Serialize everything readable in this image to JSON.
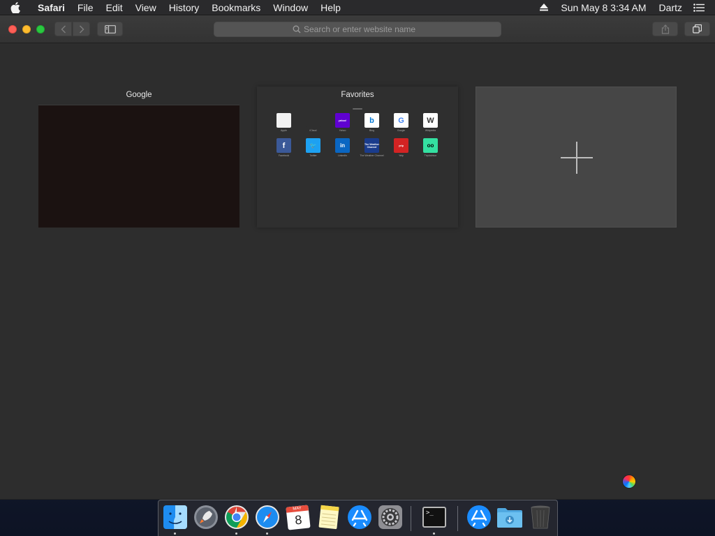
{
  "menubar": {
    "app_name": "Safari",
    "items": [
      "File",
      "Edit",
      "View",
      "History",
      "Bookmarks",
      "Window",
      "Help"
    ],
    "datetime": "Sun May 8  3:34 AM",
    "user": "Dartz"
  },
  "toolbar": {
    "address_placeholder": "Search or enter website name"
  },
  "tabs": {
    "google_title": "Google",
    "favorites_title": "Favorites"
  },
  "favorites": [
    {
      "label": "Apple",
      "icon": "apple-icon",
      "bg": "#f2f2f2",
      "fg": "#555555",
      "glyph": ""
    },
    {
      "label": "iCloud",
      "icon": "apple-icon",
      "bg": "#2f2f2f",
      "fg": "#9a9a9a",
      "glyph": ""
    },
    {
      "label": "Yahoo",
      "icon": "yahoo-icon",
      "bg": "#5f01d1",
      "fg": "#ffffff",
      "glyph": "yahoo!"
    },
    {
      "label": "Bing",
      "icon": "bing-icon",
      "bg": "#ffffff",
      "fg": "#0078d4",
      "glyph": "b"
    },
    {
      "label": "Google",
      "icon": "google-icon",
      "bg": "#ffffff",
      "fg": "#4285f4",
      "glyph": "G"
    },
    {
      "label": "Wikipedia",
      "icon": "wikipedia-icon",
      "bg": "#ffffff",
      "fg": "#333333",
      "glyph": "W"
    },
    {
      "label": "Facebook",
      "icon": "facebook-icon",
      "bg": "#3b5998",
      "fg": "#ffffff",
      "glyph": "f"
    },
    {
      "label": "Twitter",
      "icon": "twitter-icon",
      "bg": "#1da1f2",
      "fg": "#ffffff",
      "glyph": "🐦"
    },
    {
      "label": "LinkedIn",
      "icon": "linkedin-icon",
      "bg": "#0a66c2",
      "fg": "#ffffff",
      "glyph": "in"
    },
    {
      "label": "The Weather Channel",
      "icon": "weather-channel-icon",
      "bg": "#1a3c8c",
      "fg": "#ffffff",
      "glyph": "The Weather Channel"
    },
    {
      "label": "Yelp",
      "icon": "yelp-icon",
      "bg": "#d32323",
      "fg": "#ffffff",
      "glyph": "yelp"
    },
    {
      "label": "TripAdvisor",
      "icon": "tripadvisor-icon",
      "bg": "#34e0a1",
      "fg": "#000000",
      "glyph": "oo"
    }
  ],
  "dock": {
    "calendar_month": "MAY",
    "calendar_day": "8",
    "terminal_prompt": ">_"
  }
}
